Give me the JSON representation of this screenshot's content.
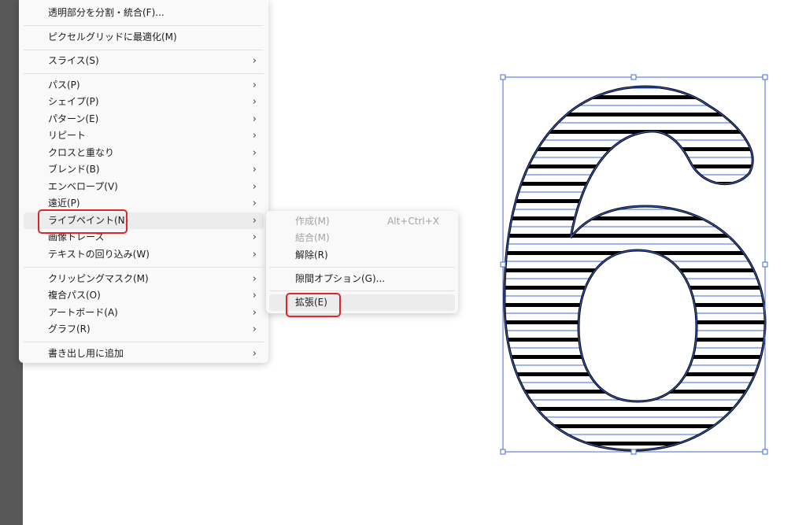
{
  "menu": {
    "items": [
      {
        "label": "透明部分を分割・統合(F)...",
        "arrow": ""
      },
      {
        "label": "ピクセルグリッドに最適化(M)",
        "arrow": ""
      },
      {
        "label": "スライス(S)",
        "arrow": "›"
      },
      {
        "label": "パス(P)",
        "arrow": "›"
      },
      {
        "label": "シェイプ(P)",
        "arrow": "›"
      },
      {
        "label": "パターン(E)",
        "arrow": "›"
      },
      {
        "label": "リピート",
        "arrow": "›"
      },
      {
        "label": "クロスと重なり",
        "arrow": "›"
      },
      {
        "label": "ブレンド(B)",
        "arrow": "›"
      },
      {
        "label": "エンベロープ(V)",
        "arrow": "›"
      },
      {
        "label": "遠近(P)",
        "arrow": "›"
      },
      {
        "label": "ライブペイント(N)",
        "arrow": "›"
      },
      {
        "label": "画像トレース",
        "arrow": "›"
      },
      {
        "label": "テキストの回り込み(W)",
        "arrow": "›"
      },
      {
        "label": "クリッピングマスク(M)",
        "arrow": "›"
      },
      {
        "label": "複合パス(O)",
        "arrow": "›"
      },
      {
        "label": "アートボード(A)",
        "arrow": "›"
      },
      {
        "label": "グラフ(R)",
        "arrow": "›"
      },
      {
        "label": "書き出し用に追加",
        "arrow": "›"
      }
    ]
  },
  "submenu": {
    "items": [
      {
        "label": "作成(M)",
        "shortcut": "Alt+Ctrl+X"
      },
      {
        "label": "結合(M)",
        "shortcut": ""
      },
      {
        "label": "解除(R)",
        "shortcut": ""
      },
      {
        "label": "隙間オプション(G)...",
        "shortcut": ""
      },
      {
        "label": "拡張(E)",
        "shortcut": ""
      }
    ]
  },
  "artwork": {
    "glyph": "6"
  },
  "colors": {
    "callout": "#e0262a",
    "selection": "#4169e1",
    "stripe_fill": "#ffffff",
    "outline": "#000000"
  }
}
